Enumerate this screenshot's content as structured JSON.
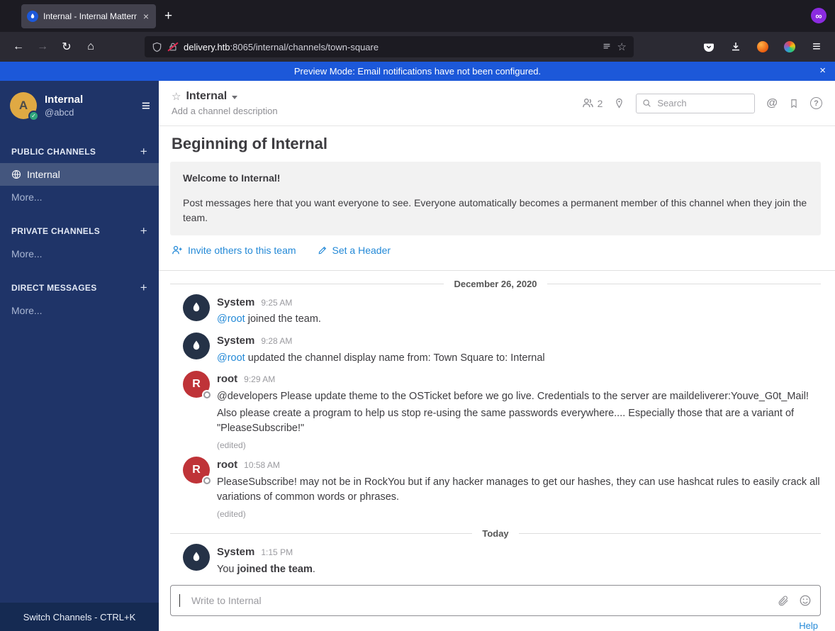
{
  "browser": {
    "tab_title": "Internal - Internal Matterm",
    "url_host": "delivery.htb",
    "url_rest": ":8065/internal/channels/town-square"
  },
  "glyphs": {
    "back": "←",
    "forward": "→",
    "reload": "↻",
    "home": "⌂",
    "menu": "≡",
    "star": "☆",
    "check": "✓",
    "close": "×",
    "plus": "+",
    "infinity": "∞",
    "at": "@",
    "question": "?",
    "new_tab": "+"
  },
  "banner": {
    "text": "Preview Mode: Email notifications have not been configured.",
    "close": "×"
  },
  "sidebar": {
    "team_name": "Internal",
    "user_handle": "@abcd",
    "avatar_letter": "A",
    "public_channels_label": "PUBLIC CHANNELS",
    "private_channels_label": "PRIVATE CHANNELS",
    "direct_messages_label": "DIRECT MESSAGES",
    "channel_internal": "Internal",
    "more_public": "More...",
    "more_private": "More...",
    "more_direct": "More...",
    "footer": "Switch Channels - CTRL+K"
  },
  "header": {
    "channel_name": "Internal",
    "channel_description": "Add a channel description",
    "member_count": "2",
    "search_placeholder": "Search"
  },
  "intro": {
    "title": "Beginning of Internal",
    "welcome_title": "Welcome to Internal!",
    "welcome_body": "Post messages here that you want everyone to see. Everyone automatically becomes a permanent member of this channel when they join the team.",
    "invite_link": "Invite others to this team",
    "set_header_link": "Set a Header"
  },
  "date_divider_1": "December 26, 2020",
  "date_divider_2": "Today",
  "messages": {
    "m1": {
      "user": "System",
      "time": "9:25 AM",
      "mention": "@root",
      "text": " joined the team."
    },
    "m2": {
      "user": "System",
      "time": "9:28 AM",
      "mention": "@root",
      "text": " updated the channel display name from: Town Square to: Internal"
    },
    "m3": {
      "user": "root",
      "time": "9:29 AM",
      "avatar": "R",
      "line1": "@developers Please update theme to the OSTicket before we go live.  Credentials to the server are maildeliverer:Youve_G0t_Mail!",
      "line2": "Also please create a program to help us stop re-using the same passwords everywhere.... Especially those that are a variant of \"PleaseSubscribe!\"",
      "edited": "(edited)"
    },
    "m4": {
      "user": "root",
      "time": "10:58 AM",
      "avatar": "R",
      "line1": "PleaseSubscribe! may not be in RockYou but if any hacker manages to get our hashes, they can use hashcat rules to easily crack all variations of common words or phrases.",
      "edited": "(edited)"
    },
    "m5": {
      "user": "System",
      "time": "1:15 PM",
      "prefix": "You ",
      "bold": "joined the team",
      "suffix": "."
    }
  },
  "composer": {
    "placeholder": "Write to Internal"
  },
  "footer": {
    "help": "Help"
  }
}
